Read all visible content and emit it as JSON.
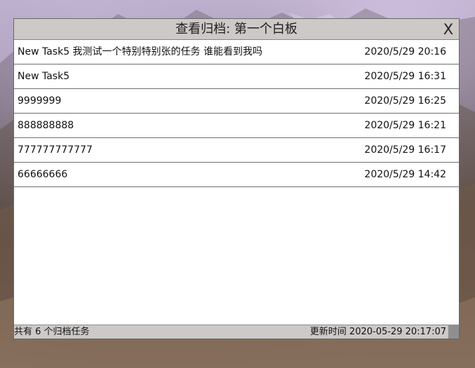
{
  "window": {
    "title": "查看归档: 第一个白板",
    "close_label": "X"
  },
  "archived_tasks": [
    {
      "title": "New Task5 我测试一个特别特别张的任务 谁能看到我吗",
      "time": "2020/5/29 20:16"
    },
    {
      "title": "New Task5",
      "time": "2020/5/29 16:31"
    },
    {
      "title": "9999999",
      "time": "2020/5/29 16:25"
    },
    {
      "title": "888888888",
      "time": "2020/5/29 16:21"
    },
    {
      "title": "777777777777",
      "time": "2020/5/29 16:17"
    },
    {
      "title": "66666666",
      "time": "2020/5/29 14:42"
    }
  ],
  "status": {
    "count_text": "共有 6 个归档任务",
    "updated_text": "更新时间 2020-05-29 20:17:07"
  },
  "theme": {
    "window_chrome": "#cdc9c7",
    "window_border": "#666666",
    "row_separator": "#6f6f6f",
    "grip": "#8f8f8f"
  }
}
